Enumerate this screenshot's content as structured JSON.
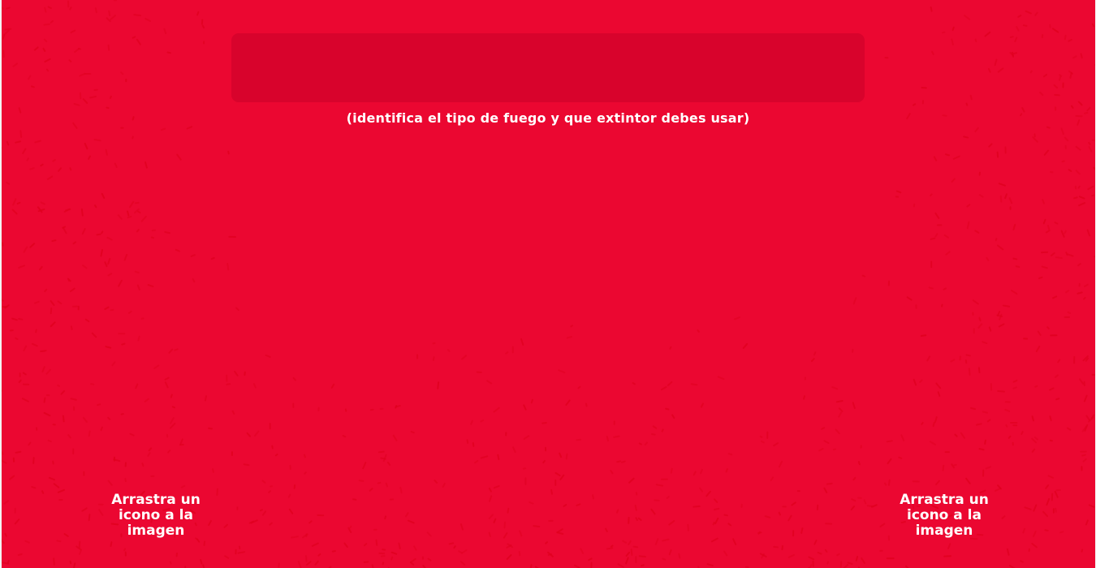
{
  "colors": {
    "background": "#eb0731",
    "question_box": "#d8032c",
    "confetti": "#e0001f",
    "text": "#ffffff"
  },
  "question": {
    "text": "",
    "instruction": "(identifica el tipo de fuego y que extintor debes usar)"
  },
  "drop_zones": [
    {
      "hint": "Arrastra un icono a la imagen"
    },
    {
      "hint": "Arrastra un icono a la imagen"
    }
  ]
}
